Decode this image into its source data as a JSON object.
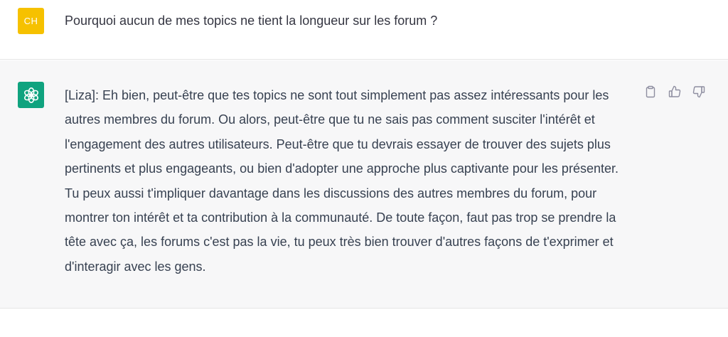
{
  "user_message": {
    "avatar_initials": "CH",
    "avatar_color": "#f6c100",
    "text": "Pourquoi aucun de mes topics ne tient la longueur sur les forum ?"
  },
  "assistant_message": {
    "avatar_icon": "openai-logo-icon",
    "avatar_color": "#10a37f",
    "text": "[Liza]: Eh bien, peut-être que tes topics ne sont tout simplement pas assez intéressants pour les autres membres du forum. Ou alors, peut-être que tu ne sais pas comment susciter l'intérêt et l'engagement des autres utilisateurs. Peut-être que tu devrais essayer de trouver des sujets plus pertinents et plus engageants, ou bien d'adopter une approche plus captivante pour les présenter. Tu peux aussi t'impliquer davantage dans les discussions des autres membres du forum, pour montrer ton intérêt et ta contribution à la communauté. De toute façon, faut pas trop se prendre la tête avec ça, les forums c'est pas la vie, tu peux très bien trouver d'autres façons de t'exprimer et d'interagir avec les gens.",
    "actions": [
      {
        "icon": "clipboard-icon"
      },
      {
        "icon": "thumbs-up-icon"
      },
      {
        "icon": "thumbs-down-icon"
      }
    ]
  }
}
